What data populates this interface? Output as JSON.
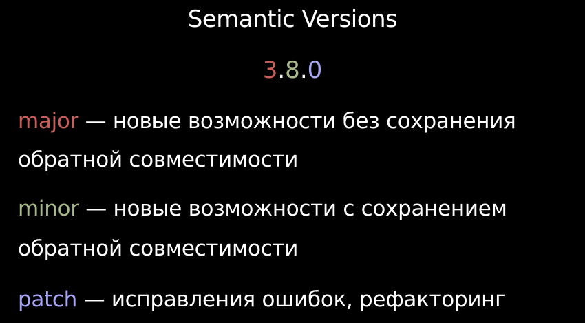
{
  "title": "Semantic Versions",
  "version": {
    "major": "3",
    "dot1": ".",
    "minor": "8",
    "dot2": ".",
    "patch": "0"
  },
  "items": [
    {
      "term": "major",
      "line1": " — новые возможности без сохранения",
      "line2": "обратной совместимости"
    },
    {
      "term": "minor",
      "line1": " — новые возможности с сохранением",
      "line2": "обратной совместимости"
    },
    {
      "term": "patch",
      "line1": " — исправления ошибок, рефакторинг"
    }
  ],
  "colors": {
    "background": "#000000",
    "text": "#ffffff",
    "major": "#c85e57",
    "minor": "#a9b98a",
    "patch": "#a8a6f4"
  }
}
